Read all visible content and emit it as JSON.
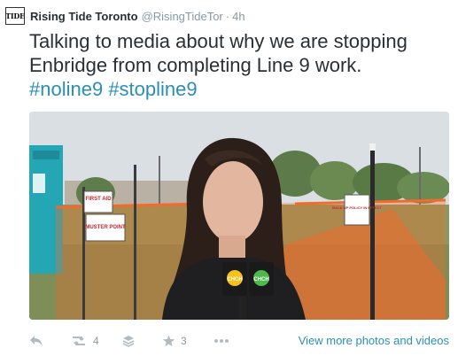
{
  "tweet": {
    "avatar_text": "TIDE",
    "author_name": "Rising Tide Toronto",
    "handle": "@RisingTideTor",
    "separator": "·",
    "time": "4h",
    "text": "Talking to media about why we are stopping Enbridge from completing Line 9 work.",
    "hashtags": [
      "#noline9",
      "#stopline9"
    ]
  },
  "media": {
    "signs": {
      "first_aid": "FIRST AID",
      "muster_point": "MUSTER POINT",
      "back_up": "BACK UP POLICY IN EFFECT"
    },
    "mic_flag_label": "CHCH"
  },
  "actions": {
    "reply_icon": "reply-icon",
    "retweet_icon": "retweet-icon",
    "retweet_count": "4",
    "buffer_icon": "layers-icon",
    "favorite_icon": "star-icon",
    "favorite_count": "3",
    "more_icon": "ellipsis-icon",
    "view_more_label": "View more photos and videos"
  },
  "colors": {
    "link": "#2b8fb5",
    "text": "#292f33",
    "muted": "#8899a6",
    "fence": "#f26a2c"
  }
}
